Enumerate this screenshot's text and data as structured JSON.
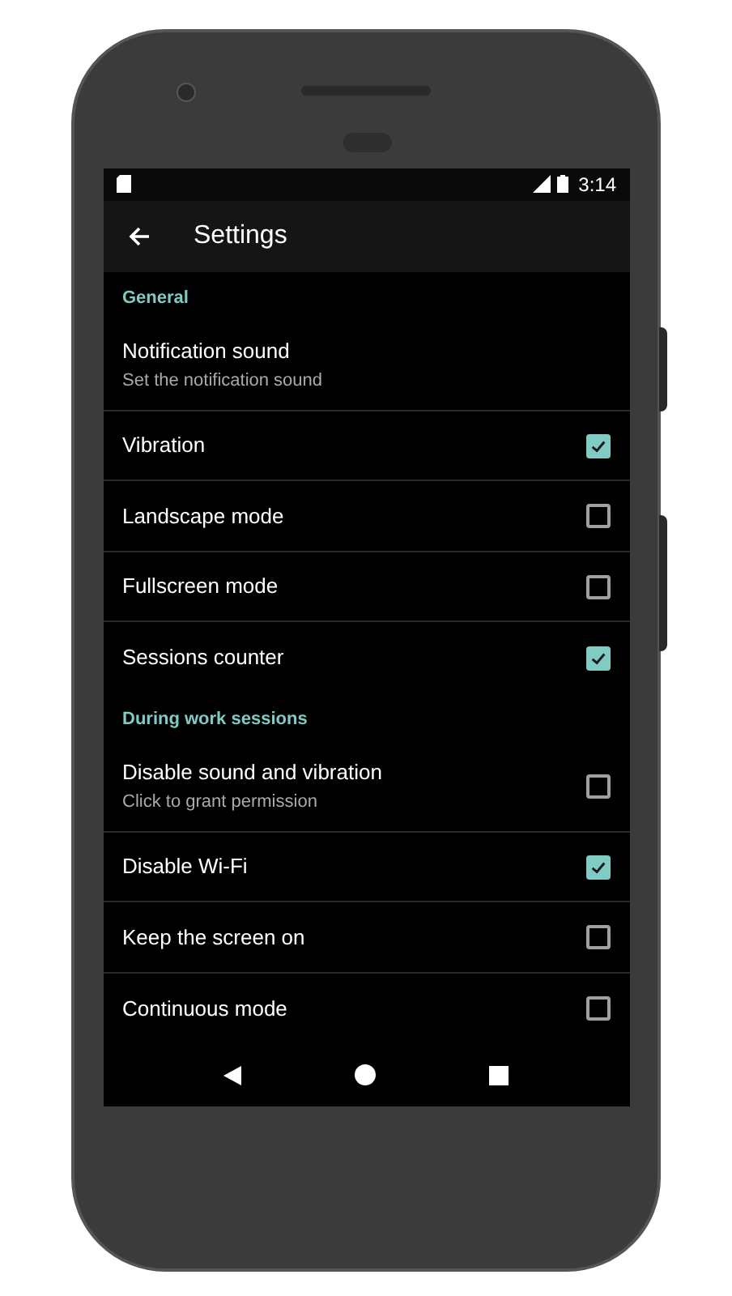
{
  "status_bar": {
    "time": "3:14"
  },
  "toolbar": {
    "title": "Settings"
  },
  "sections": [
    {
      "header": "General",
      "items": [
        {
          "kind": "text",
          "title": "Notification sound",
          "summary": "Set the notification sound"
        },
        {
          "kind": "checkbox",
          "title": "Vibration",
          "checked": true
        },
        {
          "kind": "checkbox",
          "title": "Landscape mode",
          "checked": false
        },
        {
          "kind": "checkbox",
          "title": "Fullscreen mode",
          "checked": false
        },
        {
          "kind": "checkbox",
          "title": "Sessions counter",
          "checked": true
        }
      ]
    },
    {
      "header": "During work sessions",
      "items": [
        {
          "kind": "checkbox",
          "title": "Disable sound and vibration",
          "summary": "Click to grant permission",
          "checked": false
        },
        {
          "kind": "checkbox",
          "title": "Disable Wi-Fi",
          "checked": true
        },
        {
          "kind": "checkbox",
          "title": "Keep the screen on",
          "checked": false
        },
        {
          "kind": "checkbox",
          "title": "Continuous mode",
          "checked": false
        }
      ]
    }
  ]
}
